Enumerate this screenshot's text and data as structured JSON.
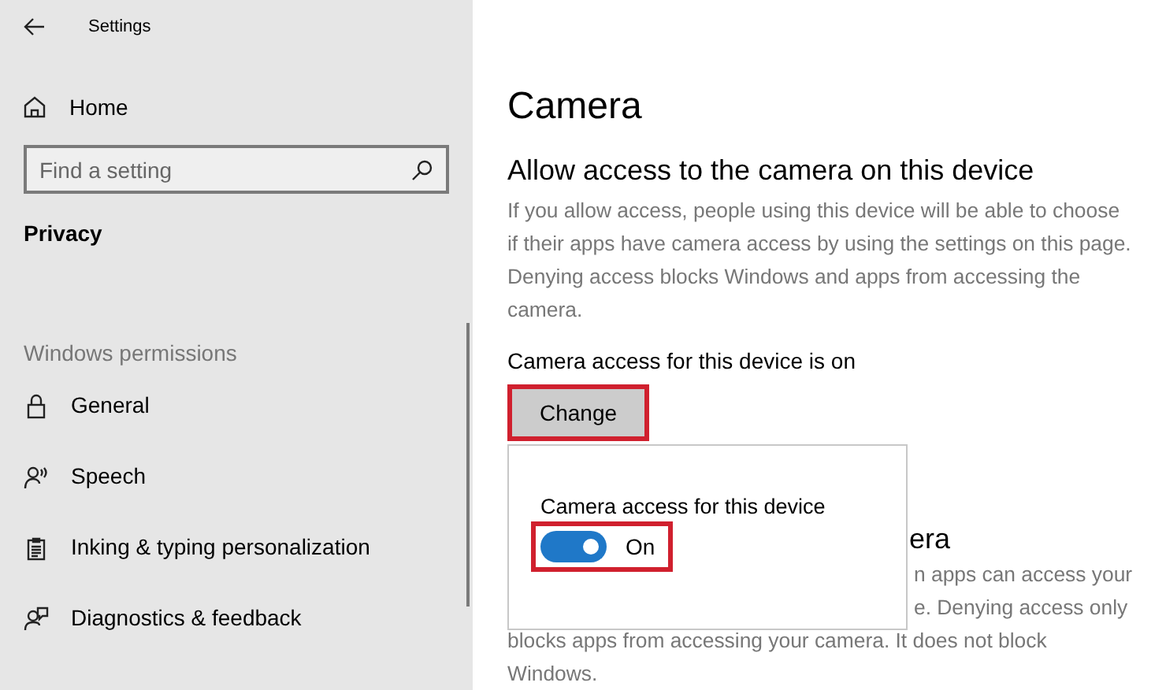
{
  "window": {
    "title": "Settings"
  },
  "sidebar": {
    "home": "Home",
    "search": {
      "placeholder": "Find a setting"
    },
    "section": "Privacy",
    "group": "Windows permissions",
    "items": [
      {
        "label": "General"
      },
      {
        "label": "Speech"
      },
      {
        "label": "Inking & typing personalization"
      },
      {
        "label": "Diagnostics & feedback"
      }
    ]
  },
  "main": {
    "title": "Camera",
    "heading": "Allow access to the camera on this device",
    "description": [
      "If you allow access, people using this device will be able to choose",
      "if their apps have camera access by using the settings on this page.",
      "Denying access blocks Windows and apps from accessing the",
      "camera."
    ],
    "status": "Camera access for this device is on",
    "change_button": {
      "label": "Change",
      "highlighted": true
    },
    "popup": {
      "label": "Camera access for this device",
      "toggle": {
        "on": true,
        "text": "On",
        "highlighted": true
      }
    },
    "covered_section": {
      "heading": "era",
      "lines": [
        "n apps can access your",
        "e. Denying access only",
        "blocks apps from accessing your camera. It does not block",
        "Windows."
      ]
    }
  }
}
